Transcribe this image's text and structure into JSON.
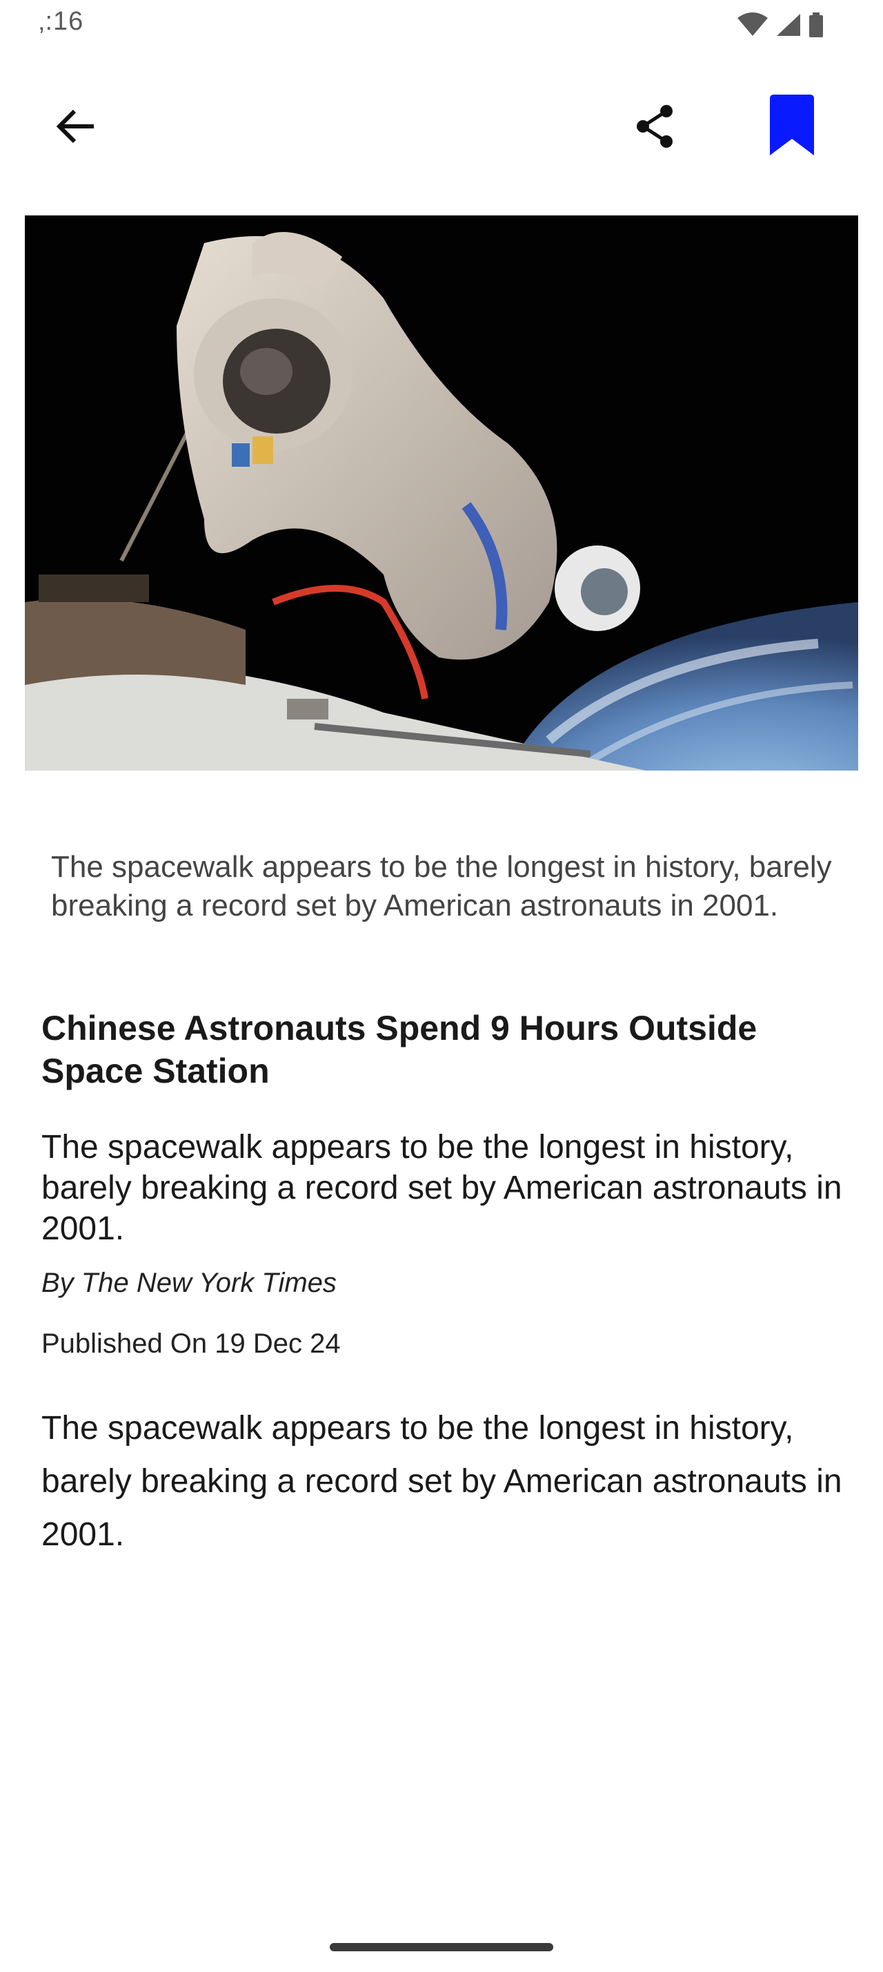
{
  "status_bar": {
    "time": "‚:16",
    "icons": [
      "wifi-icon",
      "cellular-signal-icon",
      "battery-icon"
    ]
  },
  "app_bar": {
    "back_icon": "arrow-left-icon",
    "share_icon": "share-icon",
    "bookmark_icon": "bookmark-filled-icon",
    "bookmark_color": "#0a1aff"
  },
  "article": {
    "image_caption": "The spacewalk appears to be the longest in history, barely breaking a record set by American astronauts in 2001.",
    "headline": "Chinese Astronauts Spend 9 Hours Outside Space Station",
    "summary": "The spacewalk appears to be the longest in history, barely breaking a record set by American astronauts in 2001.",
    "byline": "By The New York Times",
    "published": "Published On 19 Dec 24",
    "body": "The spacewalk appears to be the longest in history, barely breaking a record set by American astronauts in 2001."
  }
}
